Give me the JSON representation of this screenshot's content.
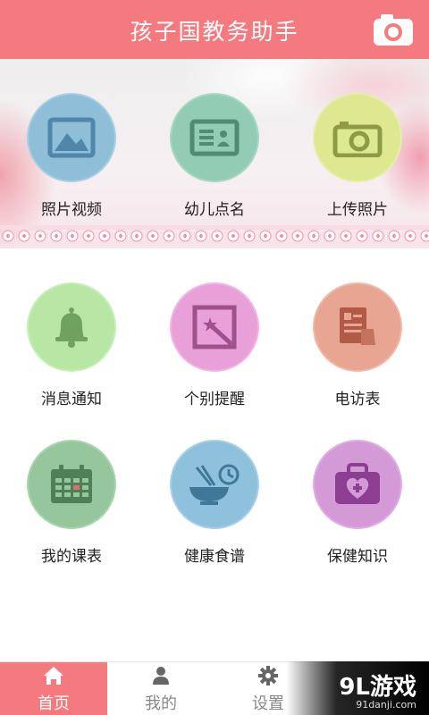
{
  "header": {
    "title": "孩子国教务助手",
    "camera_icon": "camera-icon"
  },
  "banner_items": [
    {
      "label": "照片视频",
      "icon": "picture-icon",
      "color": "#8fbfd8"
    },
    {
      "label": "幼儿点名",
      "icon": "id-card-icon",
      "color": "#93ccb4"
    },
    {
      "label": "上传照片",
      "icon": "camera-icon",
      "color": "#dde890"
    }
  ],
  "grid_items": [
    {
      "label": "消息通知",
      "icon": "bell-icon",
      "color": "#b8e6a4"
    },
    {
      "label": "个别提醒",
      "icon": "magic-wand-icon",
      "color": "#e9a0d8"
    },
    {
      "label": "电访表",
      "icon": "document-icon",
      "color": "#e7a592"
    },
    {
      "label": "我的课表",
      "icon": "calendar-icon",
      "color": "#96c79c"
    },
    {
      "label": "健康食谱",
      "icon": "bowl-clock-icon",
      "color": "#8ec2dc"
    },
    {
      "label": "保健知识",
      "icon": "medical-kit-icon",
      "color": "#d49ad8"
    }
  ],
  "tabs": [
    {
      "label": "首页",
      "icon": "home-icon",
      "active": true
    },
    {
      "label": "我的",
      "icon": "user-icon",
      "active": false
    },
    {
      "label": "设置",
      "icon": "gear-icon",
      "active": false
    }
  ],
  "watermark": {
    "brand": "9L游戏",
    "url": "91danji.com"
  },
  "colors": {
    "accent": "#f47a7f"
  }
}
